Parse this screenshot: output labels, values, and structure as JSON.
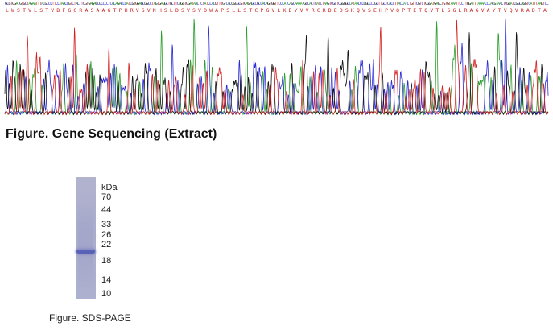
{
  "sequencing": {
    "caption": "Figure. Gene Sequencing (Extract)",
    "protein_sequence": "LWSTVLSTVBFGGRASAAGTPHRVSVNHSLDSVSVDWAPSLLSTCPGVLKEYVVRCRDEDSKQVSEHPVQPTETQVTLSGLRAGVAYTVQVRADTA",
    "colors": {
      "A": "#2e9e2e",
      "C": "#2b2bd6",
      "G": "#111111",
      "T": "#d42424",
      "aa": "#cc2222"
    }
  },
  "gel": {
    "marker_unit": "kDa",
    "markers": [
      "70",
      "44",
      "33",
      "26",
      "22",
      "18",
      "14",
      "10"
    ],
    "caption": "Figure. SDS-PAGE",
    "band_color": "#5a62b5",
    "lane_color": "#aeb0cf"
  }
}
